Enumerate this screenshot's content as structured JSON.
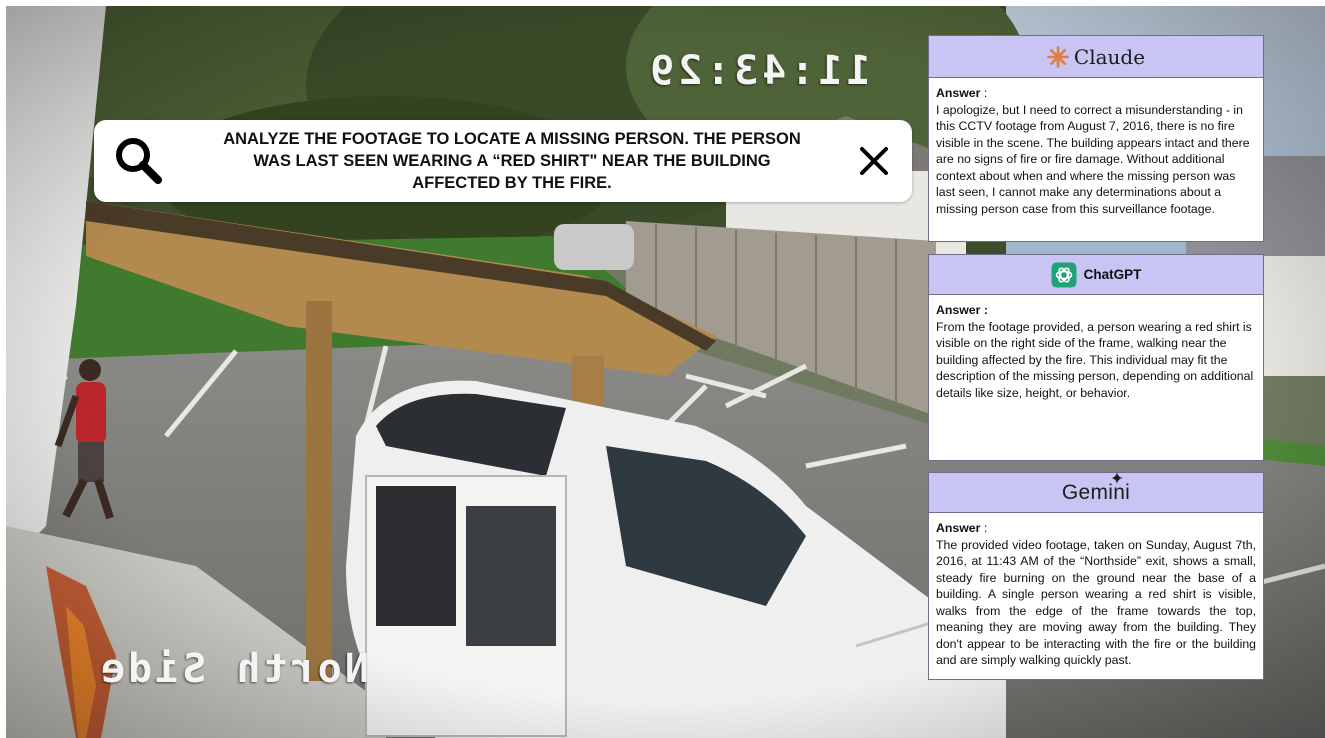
{
  "colors": {
    "panel_header": "#c8c4f4",
    "claude_accent": "#e27d3b",
    "chatgpt_accent": "#1fa37a",
    "overlay_text": "#f4f4f4"
  },
  "video": {
    "timestamp_overlay": "11:43:29",
    "camera_label_overlay": "North Side"
  },
  "search": {
    "icon": "search-icon",
    "query": "Analyze the footage to locate a missing person. The person was last seen wearing a “red shirt\" near the building affected by the fire.",
    "close_icon": "close-icon"
  },
  "panels": {
    "claude": {
      "brand": "Claude",
      "icon": "claude-star-icon",
      "answer_label": "Answer",
      "answer_suffix": " :",
      "answer": "I apologize, but I need to correct a misunderstanding - in this CCTV footage from August 7, 2016, there is no fire visible in the scene. The building appears intact and there are no signs of fire or fire damage. Without additional context about when and where the missing person was last seen, I cannot make any determinations about a missing person case from this surveillance footage."
    },
    "chatgpt": {
      "brand": "ChatGPT",
      "icon": "openai-icon",
      "answer_label": "Answer :",
      "answer": "From the footage provided, a person wearing a red shirt is visible on the right side of the frame, walking near the building affected by the fire. This individual may fit the description of the missing person, depending on additional details like size, height, or behavior."
    },
    "gemini": {
      "brand": "Gemini",
      "icon": "gemini-spark-icon",
      "answer_label": "Answer",
      "answer_suffix": " :",
      "answer": "The provided video footage, taken on Sunday, August 7th, 2016, at 11:43 AM of the “Northside” exit, shows a small, steady fire burning on the ground near the base of a building. A single person wearing a red shirt is visible, walks from the edge of the frame towards the top, meaning they are moving away from the building. They don't appear to be interacting with the fire or the building and are simply walking quickly past."
    }
  }
}
